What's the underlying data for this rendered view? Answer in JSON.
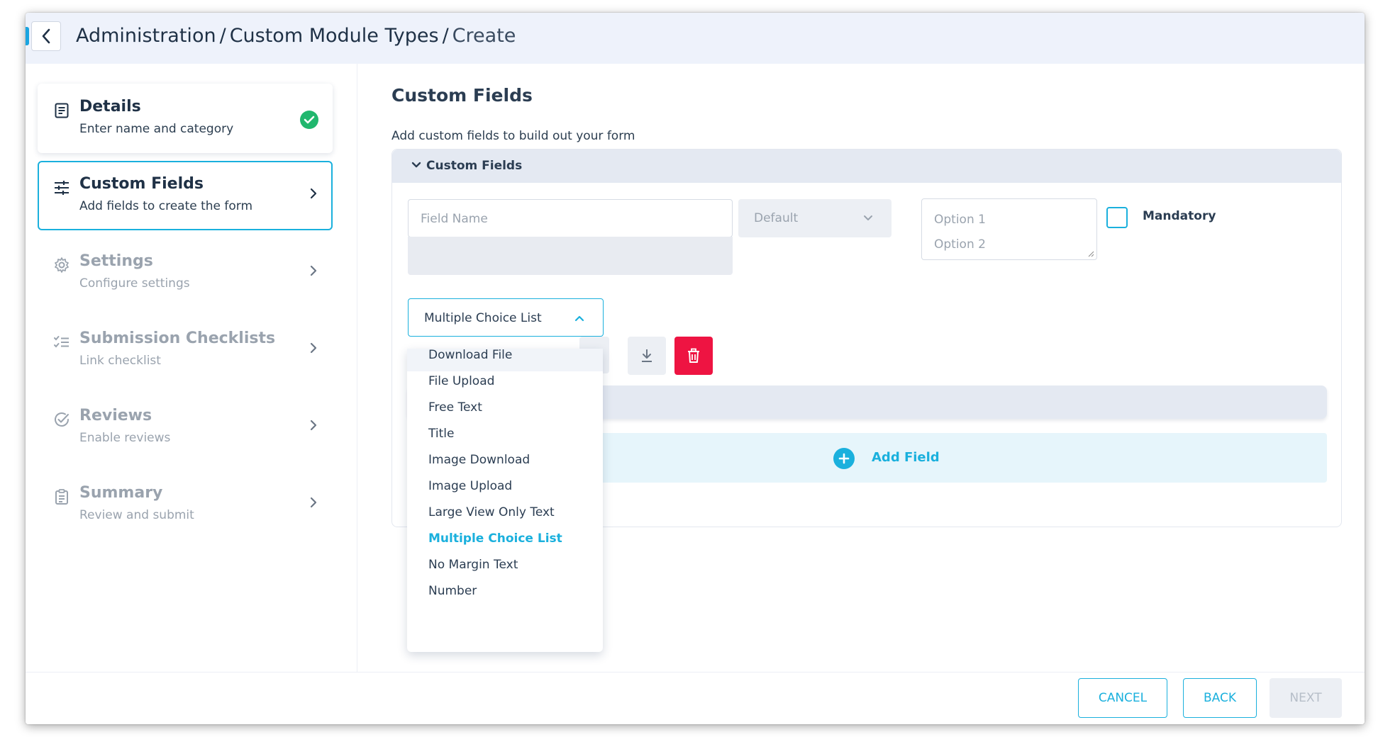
{
  "breadcrumb": {
    "items": [
      "Administration",
      "Custom Module Types",
      "Create"
    ],
    "separator": "/"
  },
  "steps": [
    {
      "title": "Details",
      "subtitle": "Enter name and category",
      "status": "complete",
      "icon": "document-icon"
    },
    {
      "title": "Custom Fields",
      "subtitle": "Add fields to create the form",
      "status": "active",
      "icon": "sliders-icon"
    },
    {
      "title": "Settings",
      "subtitle": "Configure settings",
      "status": "inactive",
      "icon": "gear-icon"
    },
    {
      "title": "Submission Checklists",
      "subtitle": "Link checklist",
      "status": "inactive",
      "icon": "checklist-icon"
    },
    {
      "title": "Reviews",
      "subtitle": "Enable reviews",
      "status": "inactive",
      "icon": "check-circle-icon"
    },
    {
      "title": "Summary",
      "subtitle": "Review and submit",
      "status": "inactive",
      "icon": "clipboard-icon"
    }
  ],
  "main": {
    "heading": "Custom Fields",
    "description": "Add custom fields to build out your form",
    "panel_title": "Custom Fields",
    "field_name_placeholder": "Field Name",
    "default_select": "Default",
    "options": [
      "Option 1",
      "Option 2"
    ],
    "mandatory_label": "Mandatory",
    "mandatory_checked": false,
    "type_select_value": "Multiple Choice List",
    "add_field_label": "Add Field"
  },
  "dropdown": {
    "items": [
      "Download File",
      "File Upload",
      "Free Text",
      "Title",
      "Image Download",
      "Image Upload",
      "Large View Only Text",
      "Multiple Choice List",
      "No Margin Text",
      "Number"
    ],
    "selected": "Multiple Choice List",
    "hovered": "Download File"
  },
  "footer": {
    "cancel": "CANCEL",
    "back": "BACK",
    "next": "NEXT"
  },
  "colors": {
    "accent": "#1ab0dd",
    "success": "#21b76e",
    "danger": "#ee1442",
    "header_bg": "#eef2fb"
  }
}
